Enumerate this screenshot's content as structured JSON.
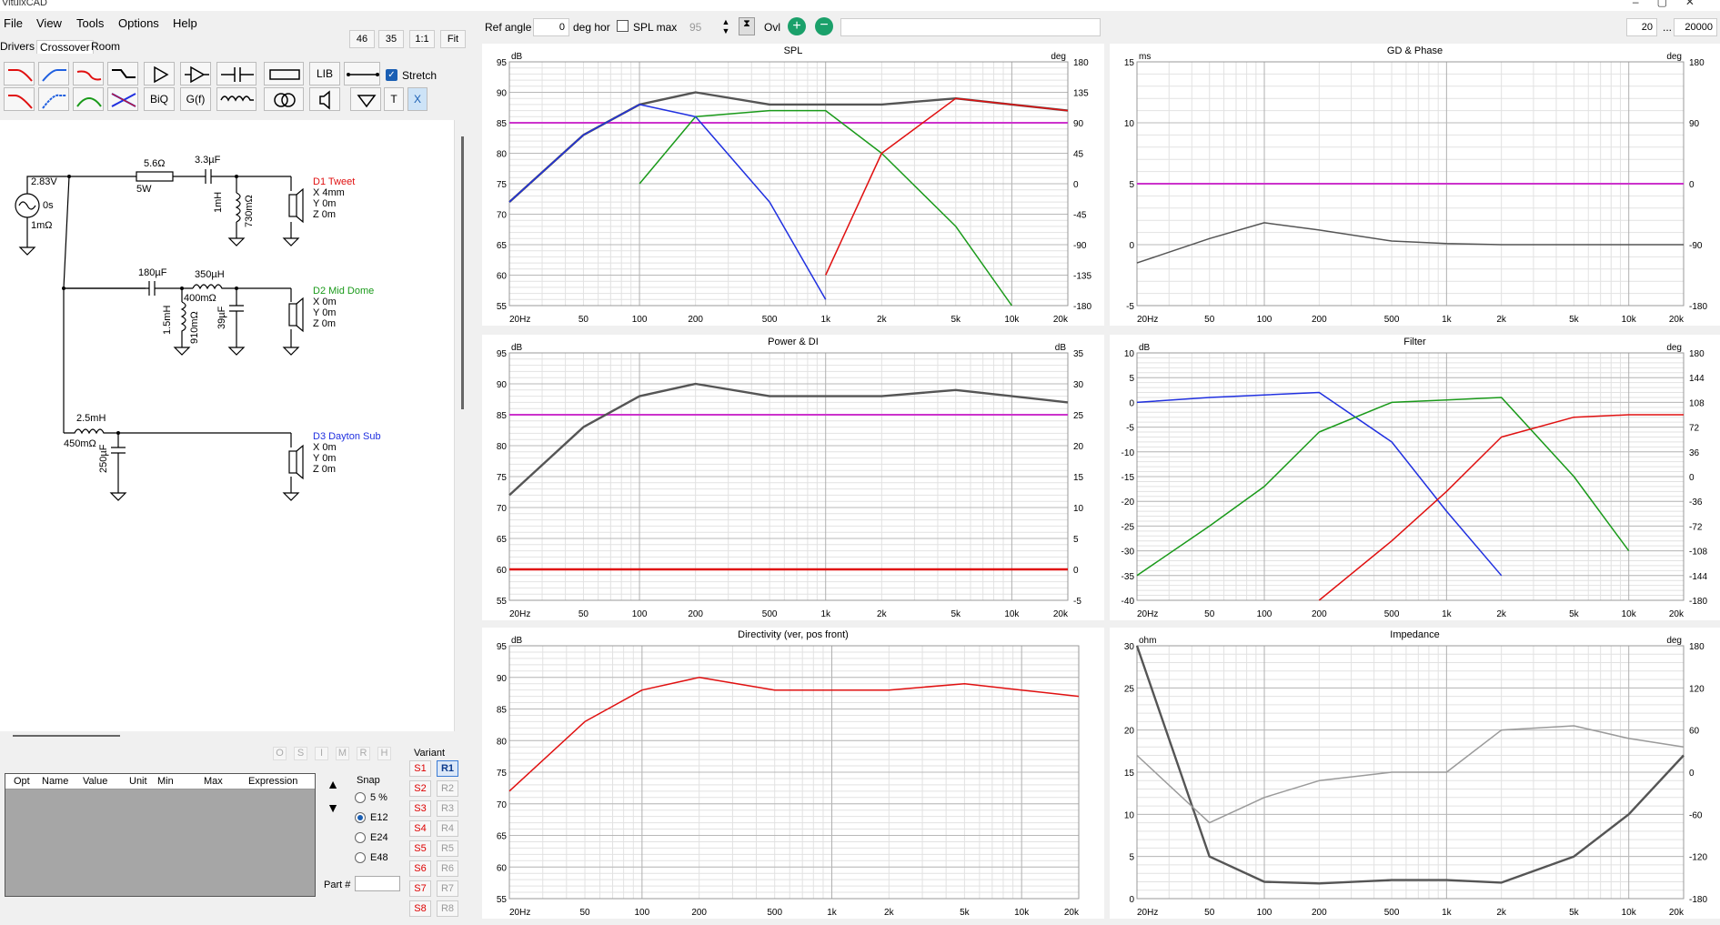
{
  "app": {
    "title": "VituixCAD"
  },
  "menu": [
    "File",
    "View",
    "Tools",
    "Options",
    "Help"
  ],
  "tabs": [
    "Drivers",
    "Crossover",
    "Room"
  ],
  "zoom_btns": [
    "46",
    "35",
    "1:1",
    "Fit"
  ],
  "toolbar": {
    "row2": [
      "BiQ",
      "G(f)"
    ],
    "lib": "LIB",
    "stretch": "Stretch",
    "t": "T",
    "x": "X"
  },
  "schematic": {
    "source": {
      "v": "2.83V",
      "delay": "0s",
      "r": "1mΩ"
    },
    "tweet": {
      "r": "5.6Ω",
      "rw": "5W",
      "c": "3.3µF",
      "l": "1mH",
      "lr": "730mΩ",
      "name": "D1 Tweet",
      "x": "X 4mm",
      "y": "Y 0m",
      "z": "Z 0m"
    },
    "mid": {
      "c": "180µF",
      "l": "350µH",
      "lr": "400mΩ",
      "l2": "1.5mH",
      "l2r": "910mΩ",
      "c2": "39µF",
      "name": "D2 Mid Dome",
      "x": "X 0m",
      "y": "Y 0m",
      "z": "Z 0m"
    },
    "sub": {
      "l": "2.5mH",
      "lr": "450mΩ",
      "c": "250µF",
      "name": "D3 Dayton Sub",
      "x": "X 0m",
      "y": "Y 0m",
      "z": "Z 0m"
    }
  },
  "opt_table": {
    "headers": [
      "Opt",
      "Name",
      "Value",
      "Unit",
      "Min",
      "Max",
      "Expression"
    ],
    "flags": [
      "O",
      "S",
      "I",
      "M",
      "R",
      "H"
    ]
  },
  "snap": {
    "label": "Snap",
    "options": [
      "5 %",
      "E12",
      "E24",
      "E48"
    ],
    "selected": "E12"
  },
  "part_label": "Part #",
  "variant": {
    "label": "Variant",
    "s": [
      "S1",
      "S2",
      "S3",
      "S4",
      "S5",
      "S6",
      "S7",
      "S8"
    ],
    "r": [
      "R1",
      "R2",
      "R3",
      "R4",
      "R5",
      "R6",
      "R7",
      "R8"
    ],
    "selected": "R1"
  },
  "graph_toolbar": {
    "ref_angle_label": "Ref angle",
    "ref_angle": "0",
    "deg_hor": "deg hor",
    "spl_max": "SPL max",
    "spl_max_val": "95",
    "ovl": "Ovl",
    "f_min": "20",
    "dots": "...",
    "f_max": "20000"
  },
  "panels": {
    "spl": {
      "title": "SPL",
      "yl": "dB",
      "yr": "deg"
    },
    "gd": {
      "title": "GD & Phase",
      "yl": "ms",
      "yr": "deg"
    },
    "power": {
      "title": "Power & DI",
      "yl": "dB",
      "yr": "dB"
    },
    "filter": {
      "title": "Filter",
      "yl": "dB",
      "yr": "deg"
    },
    "dir": {
      "title": "Directivity (ver, pos front)",
      "yl": "dB"
    },
    "imp": {
      "title": "Impedance",
      "yl": "ohm",
      "yr": "deg"
    }
  },
  "freq_ticks": [
    "20Hz",
    "50",
    "100",
    "200",
    "500",
    "1k",
    "2k",
    "5k",
    "10k",
    "20k"
  ],
  "colors": {
    "tweet": "#e01010",
    "mid": "#1a9a1a",
    "sub": "#2030e0",
    "sum": "#555555",
    "ref": "#cc33cc",
    "grey": "#9a9a9a"
  },
  "chart_data": [
    {
      "type": "line",
      "title": "SPL",
      "ylabel": "dB",
      "ylim": [
        55,
        95
      ],
      "y2lim": [
        -180,
        180
      ],
      "x": [
        20,
        50,
        100,
        200,
        500,
        1000,
        2000,
        5000,
        10000,
        20000
      ],
      "series": [
        {
          "values": [
            72,
            83,
            88,
            90,
            88,
            88,
            88,
            89,
            88,
            87
          ]
        },
        {
          "values": [
            null,
            null,
            75,
            86,
            87,
            87,
            80,
            68,
            55,
            null
          ]
        },
        {
          "values": [
            72,
            83,
            88,
            86,
            72,
            56,
            null,
            null,
            null,
            null
          ]
        },
        {
          "values": [
            null,
            null,
            null,
            null,
            null,
            60,
            80,
            89,
            88,
            87
          ]
        }
      ]
    },
    {
      "type": "line",
      "title": "GD & Phase",
      "ylabel": "ms",
      "ylim": [
        -5,
        15
      ],
      "y2lim": [
        -180,
        180
      ],
      "x": [
        20,
        50,
        100,
        200,
        500,
        1000,
        2000,
        5000,
        10000,
        20000
      ],
      "series": [
        {
          "values": [
            -1.5,
            0.5,
            1.8,
            1.2,
            0.3,
            0.1,
            0,
            0,
            0,
            0
          ]
        }
      ]
    },
    {
      "type": "line",
      "title": "Power & DI",
      "ylabel": "dB",
      "ylim": [
        55,
        95
      ],
      "y2lim": [
        -5,
        35
      ],
      "x": [
        20,
        50,
        100,
        200,
        500,
        1000,
        2000,
        5000,
        10000,
        20000
      ],
      "series": [
        {
          "values": [
            72,
            83,
            88,
            90,
            88,
            88,
            88,
            89,
            88,
            87
          ]
        }
      ]
    },
    {
      "type": "line",
      "title": "Filter",
      "ylabel": "dB",
      "ylim": [
        -40,
        10
      ],
      "y2lim": [
        -180,
        180
      ],
      "x": [
        20,
        50,
        100,
        200,
        500,
        1000,
        2000,
        5000,
        10000,
        20000
      ],
      "series": [
        {
          "values": [
            0,
            1,
            1.5,
            2,
            -8,
            -22,
            -35,
            null,
            null,
            null
          ]
        },
        {
          "values": [
            -35,
            -25,
            -17,
            -6,
            0,
            0.5,
            1,
            -15,
            -30,
            null
          ]
        },
        {
          "values": [
            null,
            null,
            null,
            -40,
            -28,
            -18,
            -7,
            -3,
            -2.5,
            -2.5
          ]
        }
      ]
    },
    {
      "type": "line",
      "title": "Directivity (ver, pos front)",
      "ylabel": "dB",
      "ylim": [
        55,
        95
      ],
      "x": [
        20,
        50,
        100,
        200,
        500,
        1000,
        2000,
        5000,
        10000,
        20000
      ],
      "series": [
        {
          "values": [
            72,
            83,
            88,
            90,
            88,
            88,
            88,
            89,
            88,
            87
          ]
        }
      ]
    },
    {
      "type": "line",
      "title": "Impedance",
      "ylabel": "ohm",
      "ylim": [
        0,
        30
      ],
      "y2lim": [
        -180,
        180
      ],
      "x": [
        20,
        50,
        100,
        200,
        500,
        1000,
        2000,
        5000,
        10000,
        20000
      ],
      "series": [
        {
          "values": [
            30,
            5,
            2,
            1.8,
            2.2,
            2.2,
            1.9,
            5,
            10,
            17
          ]
        },
        {
          "values": [
            17,
            9,
            12,
            14,
            15,
            15,
            20,
            20.5,
            19,
            18
          ]
        }
      ]
    }
  ]
}
